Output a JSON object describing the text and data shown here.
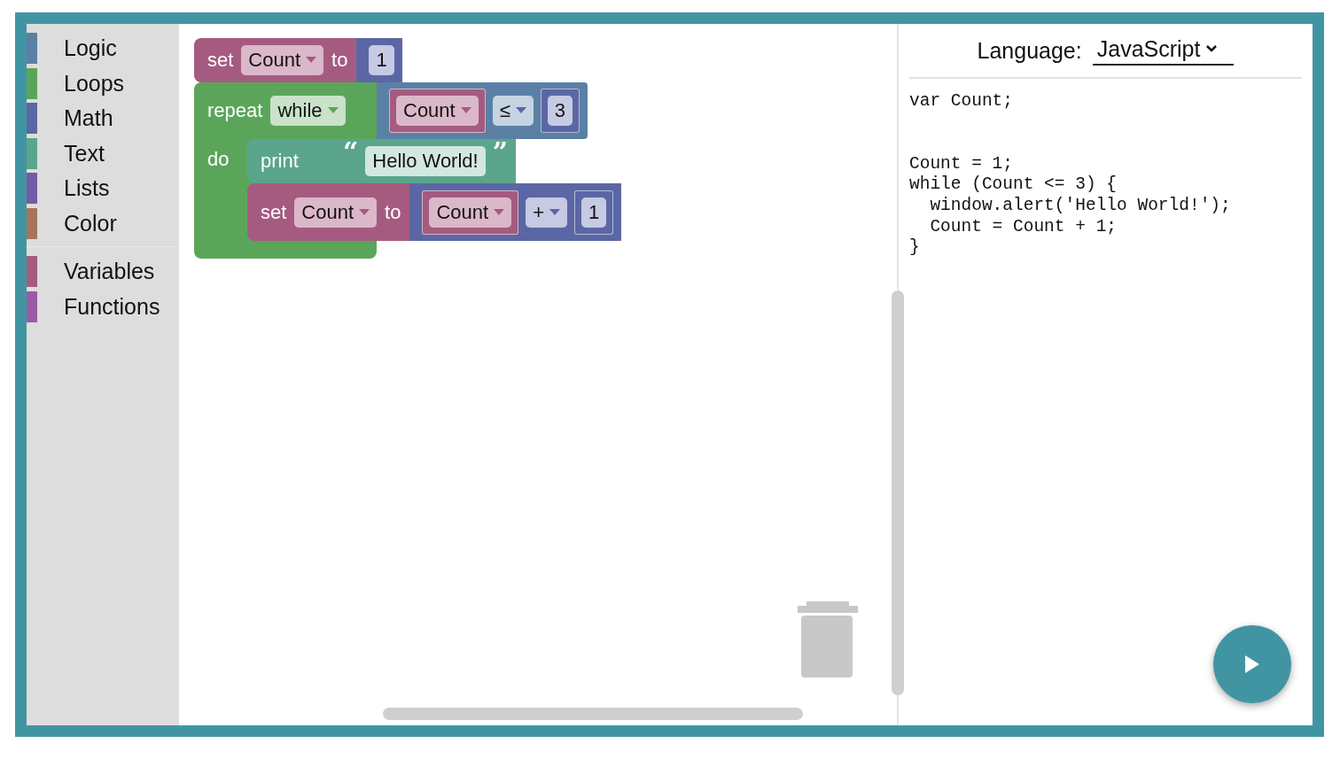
{
  "toolbox": {
    "groups": [
      {
        "categories": [
          {
            "label": "Logic",
            "color": "#5b80a5"
          },
          {
            "label": "Loops",
            "color": "#5ba55b"
          },
          {
            "label": "Math",
            "color": "#5b67a5"
          },
          {
            "label": "Text",
            "color": "#5ba58c"
          },
          {
            "label": "Lists",
            "color": "#745ba5"
          },
          {
            "label": "Color",
            "color": "#a5745b"
          }
        ]
      },
      {
        "categories": [
          {
            "label": "Variables",
            "color": "#a55b80"
          },
          {
            "label": "Functions",
            "color": "#995ba5"
          }
        ]
      }
    ]
  },
  "workspace": {
    "program": [
      {
        "kind": "set",
        "label": "set",
        "variable": "Count",
        "connector": "to",
        "value": {
          "kind": "number",
          "text": "1"
        }
      },
      {
        "kind": "while",
        "label": "repeat",
        "mode": "while",
        "do_label": "do",
        "condition": {
          "kind": "compare",
          "left": {
            "kind": "variable",
            "name": "Count"
          },
          "op": "≤",
          "right": {
            "kind": "number",
            "text": "3"
          }
        },
        "body": [
          {
            "kind": "print",
            "label": "print",
            "value": {
              "kind": "text",
              "open": "“",
              "text": "Hello World!",
              "close": "”"
            }
          },
          {
            "kind": "set",
            "label": "set",
            "variable": "Count",
            "connector": "to",
            "value": {
              "kind": "arithmetic",
              "left": {
                "kind": "variable",
                "name": "Count"
              },
              "op": "+",
              "right": {
                "kind": "number",
                "text": "1"
              }
            }
          }
        ]
      }
    ]
  },
  "code_panel": {
    "language_label": "Language:",
    "language": "JavaScript",
    "code": "var Count;\n\n\nCount = 1;\nwhile (Count <= 3) {\n  window.alert('Hello World!');\n  Count = Count + 1;\n}"
  }
}
